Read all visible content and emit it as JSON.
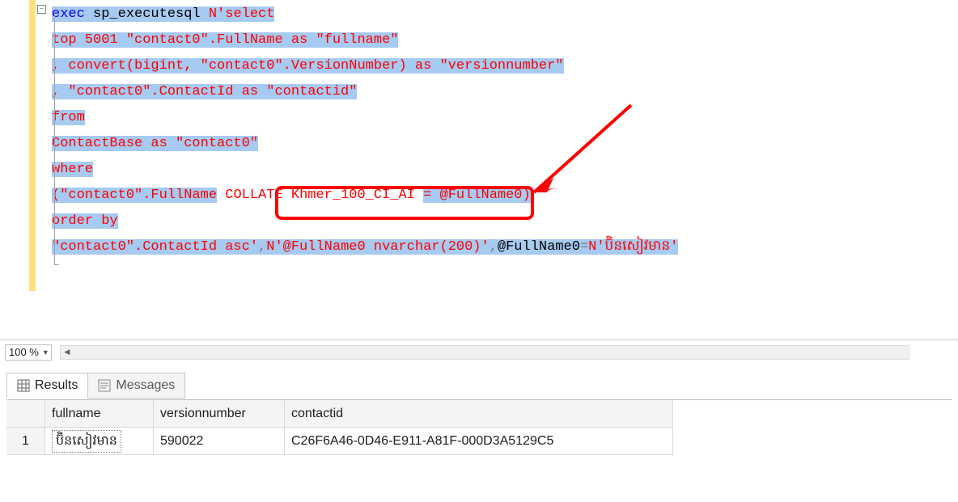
{
  "editor": {
    "collapse_glyph": "−",
    "exec_kw": "exec",
    "sp_name": " sp_executesql ",
    "n_prefix": "N",
    "q1": "'",
    "select_kw": "select",
    "line2": "top 5001 \"contact0\".FullName as \"fullname\"",
    "line3": ", convert(bigint, \"contact0\".VersionNumber) as \"versionnumber\"",
    "line4": ", \"contact0\".ContactId as \"contactid\"",
    "line5": "from",
    "line6": " ContactBase as \"contact0\"",
    "line7": "where",
    "line8a": " (\"contact0\".FullName",
    "line8b": " COLLATE Khmer_100_CI_AI ",
    "line8c": "= @FullName0)",
    "line9": "order by",
    "line10a": " \"contact0\".ContactId asc'",
    "comma1": ",",
    "line10b": "N",
    "line10c": "'@FullName0 nvarchar(200)'",
    "comma2": ",",
    "param_name": "@FullName0",
    "eq": "=",
    "line10d": "N",
    "line10e_open": "'",
    "line10e_val": "ប៊ិនសៀវមាន",
    "line10e_close": "'"
  },
  "zoom": {
    "level": "100 %"
  },
  "tabs": {
    "results": "Results",
    "messages": "Messages"
  },
  "grid": {
    "headers": {
      "c1": "fullname",
      "c2": "versionnumber",
      "c3": "contactid"
    },
    "row1": {
      "num": "1",
      "fullname": "ប៊ិនសៀវមាន",
      "versionnumber": "590022",
      "contactid": "C26F6A46-0D46-E911-A81F-000D3A5129C5"
    }
  }
}
